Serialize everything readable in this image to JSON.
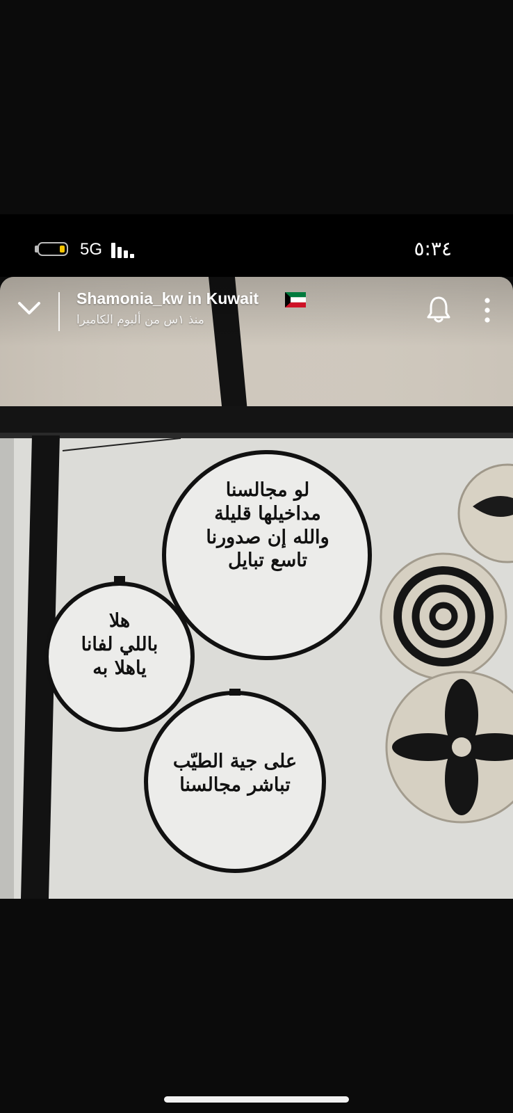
{
  "status_bar": {
    "network": "5G",
    "time": "٥:٣٤",
    "battery_level": 0.2
  },
  "story_header": {
    "username": "Shamonia_kw in Kuwait",
    "subtitle": "منذ ١س من ألبوم الكاميرا",
    "icons": [
      "chevron-down-icon",
      "kuwait-flag-icon",
      "bell-icon",
      "more-vertical-icon"
    ]
  },
  "photo": {
    "hoops": [
      {
        "lines": [
          "لو مجالسنا",
          "مداخيلها قليلة",
          "والله إن صدورنا",
          "تاسع تبايل"
        ]
      },
      {
        "lines": [
          "هلا",
          "باللي لفانا",
          "ياهلا به"
        ]
      },
      {
        "lines": [
          "على جية الطيّب",
          "تباشر مجالسنا"
        ]
      }
    ]
  },
  "colors": {
    "background": "#0b0b0b",
    "battery_fill": "#f6c400",
    "wall": "#dcdcd8",
    "frame": "#111111"
  }
}
